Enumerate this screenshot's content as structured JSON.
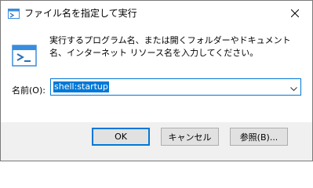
{
  "window": {
    "title": "ファイル名を指定して実行",
    "close_icon": "close-icon",
    "app_icon": "run-dialog-icon"
  },
  "content": {
    "description": "実行するプログラム名、または開くフォルダーやドキュメント名、インターネット リソース名を入力してください。",
    "open_label": "名前(O):",
    "command_value": "shell:startup"
  },
  "buttons": {
    "ok": "OK",
    "cancel": "キャンセル",
    "browse": "参照(B)..."
  },
  "colors": {
    "accent": "#0078d7",
    "footer_bg": "#f0f0f0",
    "button_bg": "#e1e1e1"
  }
}
